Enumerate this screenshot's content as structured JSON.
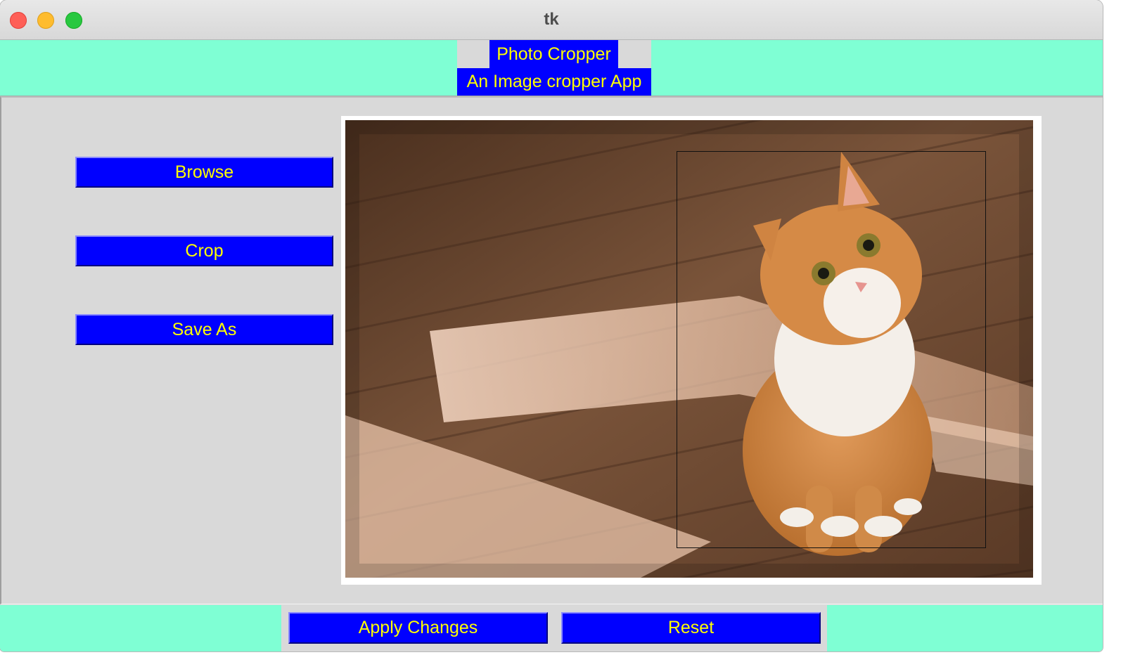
{
  "window": {
    "title": "tk",
    "controls": [
      "close-button",
      "minimize-button",
      "zoom-button"
    ]
  },
  "header": {
    "title": "Photo Cropper",
    "subtitle": "An Image cropper App"
  },
  "sidebar": {
    "buttons": [
      {
        "label": "Browse"
      },
      {
        "label": "Crop"
      },
      {
        "label": "Save As"
      }
    ]
  },
  "canvas": {
    "image_subject": "orange and white cat sitting on wooden floor",
    "has_crop_selection": true
  },
  "footer": {
    "buttons": [
      {
        "label": "Apply Changes"
      },
      {
        "label": "Reset"
      }
    ]
  },
  "colors": {
    "accent_bg": "#7fffd4",
    "button_bg": "#0000ff",
    "button_text": "#ffff00",
    "panel_bg": "#d9d9d9"
  }
}
